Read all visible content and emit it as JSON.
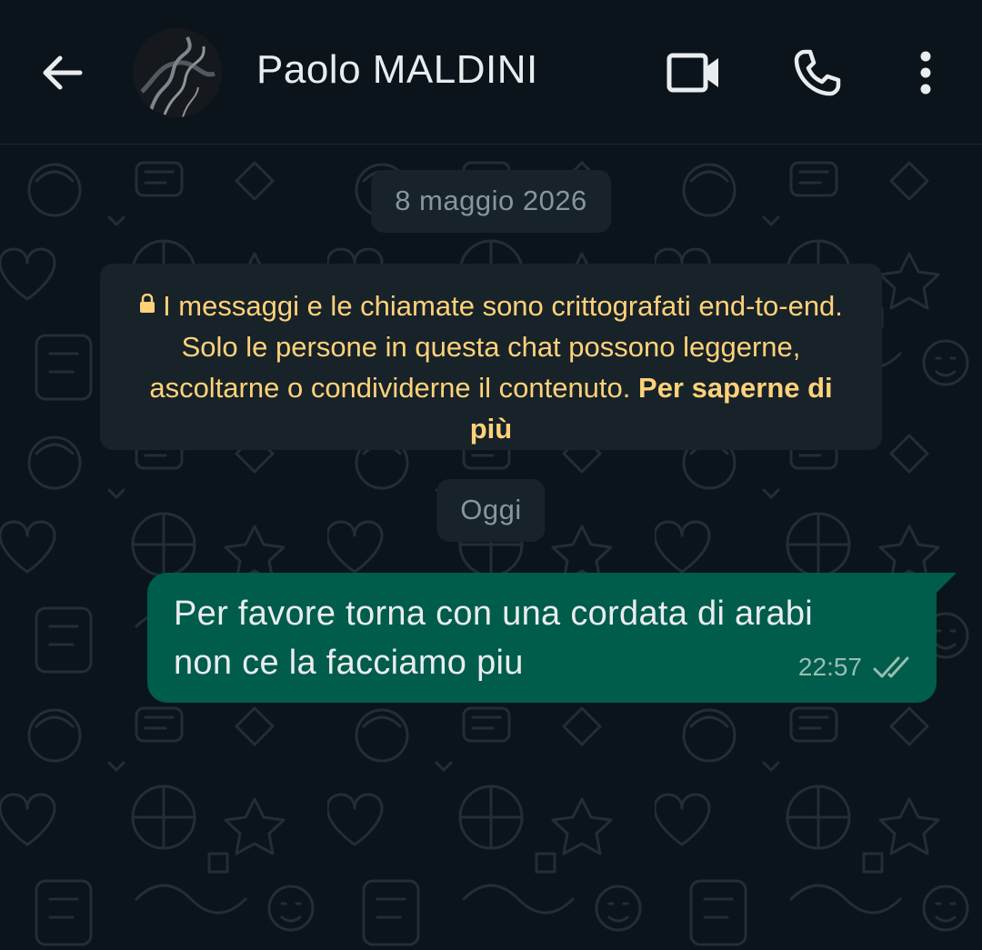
{
  "header": {
    "contact_name": "Paolo MALDINI"
  },
  "chat": {
    "date_chip_1": "8 maggio 2026",
    "encryption_notice": {
      "text": "I messaggi e le chiamate sono crittografati end-to-end. Solo le persone in questa chat possono leggerne, ascoltarne o condividerne il contenuto.",
      "link": "Per saperne di più"
    },
    "date_chip_2": "Oggi",
    "messages": [
      {
        "text": "Per favore torna con una cordata di arabi non ce la facciamo piu",
        "time": "22:57",
        "status": "read"
      }
    ]
  },
  "colors": {
    "background": "#0b141a",
    "outgoing_bubble": "#005c4b",
    "chip_background": "#182229",
    "notice_text": "#ffd279",
    "primary_text": "#e9edef",
    "secondary_text": "#8696a0"
  },
  "icons": {
    "back": "arrow-left-icon",
    "video": "video-call-icon",
    "call": "phone-icon",
    "menu": "more-vertical-icon",
    "lock": "lock-icon",
    "ticks": "double-check-icon"
  }
}
